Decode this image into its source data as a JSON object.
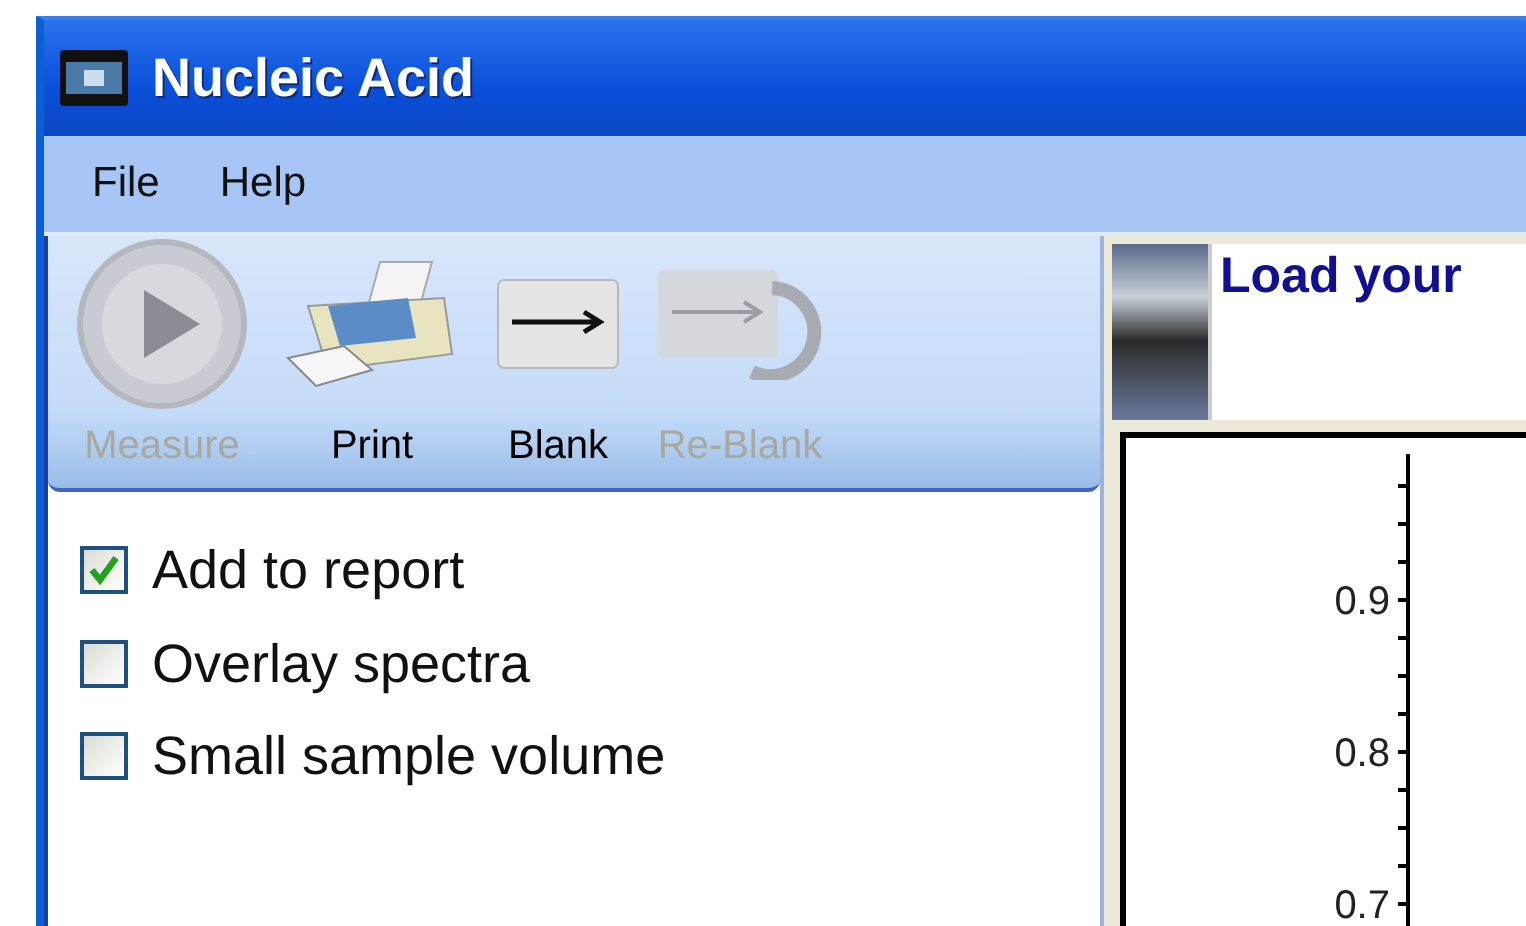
{
  "window": {
    "title": "Nucleic Acid"
  },
  "menu": [
    "File",
    "Help"
  ],
  "toolbar": [
    {
      "kind": "measure",
      "label": "Measure",
      "disabled": true
    },
    {
      "kind": "print",
      "label": "Print",
      "disabled": false
    },
    {
      "kind": "blank",
      "label": "Blank",
      "disabled": false
    },
    {
      "kind": "reblank",
      "label": "Re-Blank",
      "disabled": true
    }
  ],
  "options": [
    {
      "label": "Add to report",
      "checked": true
    },
    {
      "label": "Overlay spectra",
      "checked": false
    },
    {
      "label": "Small sample volume",
      "checked": false
    }
  ],
  "instruction": {
    "text": "Load your"
  },
  "chart": {
    "axis_labels": [
      "0.9",
      "0.8",
      "0.7"
    ]
  }
}
